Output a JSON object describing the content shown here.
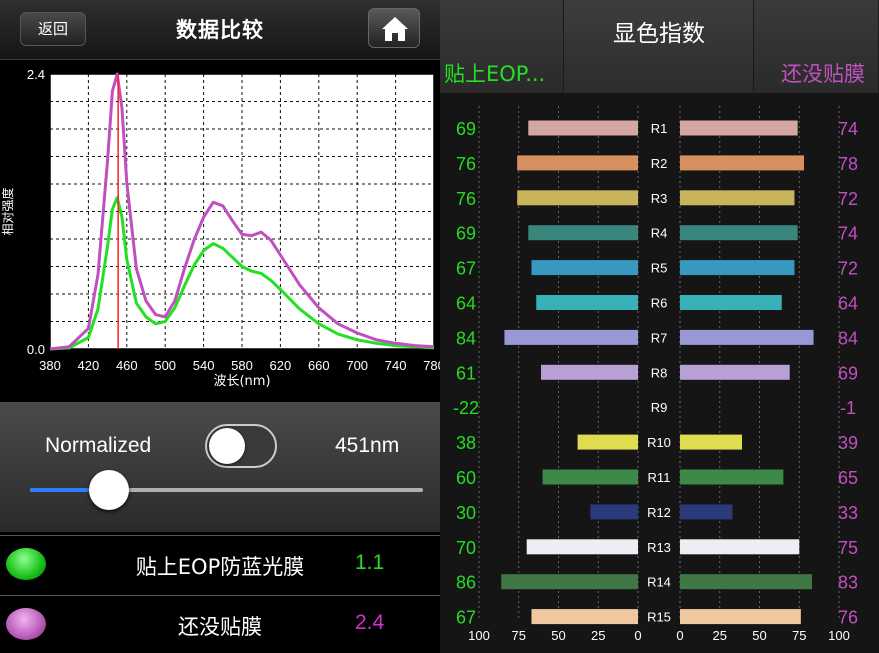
{
  "header": {
    "back_label": "返回",
    "title": "数据比较"
  },
  "controls": {
    "normalized_label": "Normalized",
    "normalized_on": false,
    "wavelength": "451nm",
    "slider_value": 0.2
  },
  "legend": [
    {
      "name": "贴上EOP防蓝光膜",
      "value": "1.1",
      "color": "#22dd22",
      "value_color": "#22dd22"
    },
    {
      "name": "还没贴膜",
      "value": "2.4",
      "color": "#b85ab8",
      "value_color": "#d030d0"
    }
  ],
  "ri_header": {
    "title": "显色指数",
    "left_label": "贴上EOP...",
    "right_label": "还没贴膜"
  },
  "colors": {
    "green": "#22dd22",
    "purple": "#c050c0",
    "marker": "#ff2020"
  },
  "chart_data": [
    {
      "type": "line",
      "title": "",
      "xlabel": "波长(nm)",
      "ylabel": "相对强度",
      "xlim": [
        380,
        780
      ],
      "ylim": [
        0,
        2.4
      ],
      "xticks": [
        "380",
        "420",
        "460",
        "500",
        "540",
        "580",
        "620",
        "660",
        "700",
        "740",
        "780"
      ],
      "yticks": [
        "0.0",
        "2.4"
      ],
      "marker_x": 451,
      "grid": true,
      "x": [
        380,
        400,
        420,
        430,
        440,
        445,
        450,
        455,
        460,
        470,
        480,
        490,
        500,
        510,
        520,
        530,
        540,
        550,
        560,
        570,
        580,
        590,
        600,
        610,
        620,
        640,
        660,
        680,
        700,
        720,
        740,
        760,
        780
      ],
      "series": [
        {
          "color": "#22e022",
          "values": [
            0.0,
            0.01,
            0.1,
            0.35,
            0.9,
            1.22,
            1.32,
            1.15,
            0.78,
            0.4,
            0.28,
            0.22,
            0.24,
            0.36,
            0.55,
            0.73,
            0.86,
            0.92,
            0.88,
            0.8,
            0.72,
            0.68,
            0.66,
            0.6,
            0.52,
            0.35,
            0.22,
            0.13,
            0.08,
            0.05,
            0.03,
            0.02,
            0.01
          ]
        },
        {
          "color": "#c050c0",
          "values": [
            0.0,
            0.02,
            0.18,
            0.65,
            1.65,
            2.25,
            2.4,
            2.1,
            1.45,
            0.7,
            0.42,
            0.3,
            0.28,
            0.42,
            0.7,
            0.95,
            1.15,
            1.28,
            1.25,
            1.12,
            1.0,
            0.99,
            1.02,
            0.95,
            0.82,
            0.56,
            0.36,
            0.22,
            0.14,
            0.08,
            0.05,
            0.03,
            0.02
          ]
        }
      ]
    },
    {
      "type": "bar",
      "title": "",
      "categories": [
        "R1",
        "R2",
        "R3",
        "R4",
        "R5",
        "R6",
        "R7",
        "R8",
        "R9",
        "R10",
        "R11",
        "R12",
        "R13",
        "R14",
        "R15"
      ],
      "left_values": [
        69,
        76,
        76,
        69,
        67,
        64,
        84,
        61,
        -22,
        38,
        60,
        30,
        70,
        86,
        67
      ],
      "right_values": [
        74,
        78,
        72,
        74,
        72,
        64,
        84,
        69,
        -1,
        39,
        65,
        33,
        75,
        83,
        76
      ],
      "bar_colors": [
        "#d4a8a0",
        "#d89060",
        "#c8b45a",
        "#38867c",
        "#3898c0",
        "#38b0b8",
        "#9898d4",
        "#b8a0d4",
        "#d23040",
        "#e0dc50",
        "#3d8a48",
        "#2a3a7a",
        "#f0ecf4",
        "#3f7845",
        "#f0c8a0"
      ],
      "left_axis_ticks": [
        "100",
        "75",
        "50",
        "25",
        "0"
      ],
      "right_axis_ticks": [
        "0",
        "25",
        "50",
        "75",
        "100"
      ],
      "xlim": [
        0,
        100
      ],
      "left_value_color": "#22dd22",
      "right_value_color": "#c050c0"
    }
  ]
}
